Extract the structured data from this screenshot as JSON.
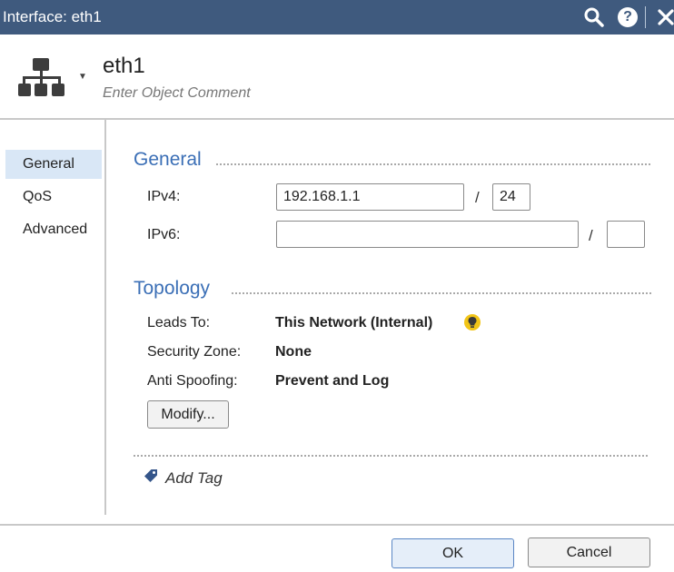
{
  "window": {
    "title": "Interface: eth1",
    "icons": [
      "search-icon",
      "help-icon",
      "close-icon"
    ]
  },
  "header": {
    "object_icon": "network-hierarchy-icon",
    "name": "eth1",
    "comment_placeholder": "Enter Object Comment"
  },
  "sidebar": {
    "items": [
      {
        "label": "General",
        "active": true
      },
      {
        "label": "QoS",
        "active": false
      },
      {
        "label": "Advanced",
        "active": false
      }
    ]
  },
  "general": {
    "title": "General",
    "ipv4": {
      "label": "IPv4:",
      "address": "192.168.1.1",
      "separator": "/",
      "mask": "24"
    },
    "ipv6": {
      "label": "IPv6:",
      "address": "",
      "separator": "/",
      "mask": ""
    }
  },
  "topology": {
    "title": "Topology",
    "leads_to": {
      "label": "Leads To:",
      "value": "This Network (Internal)"
    },
    "security_zone": {
      "label": "Security Zone:",
      "value": "None"
    },
    "anti_spoofing": {
      "label": "Anti Spoofing:",
      "value": "Prevent and Log"
    },
    "modify_label": "Modify..."
  },
  "tags": {
    "add_label": "Add Tag"
  },
  "footer": {
    "ok_label": "OK",
    "cancel_label": "Cancel"
  },
  "colors": {
    "titlebar": "#3f5a7e",
    "section_title": "#3b6fb6",
    "active_nav": "#d9e7f6",
    "bulb": "#f2c518"
  }
}
